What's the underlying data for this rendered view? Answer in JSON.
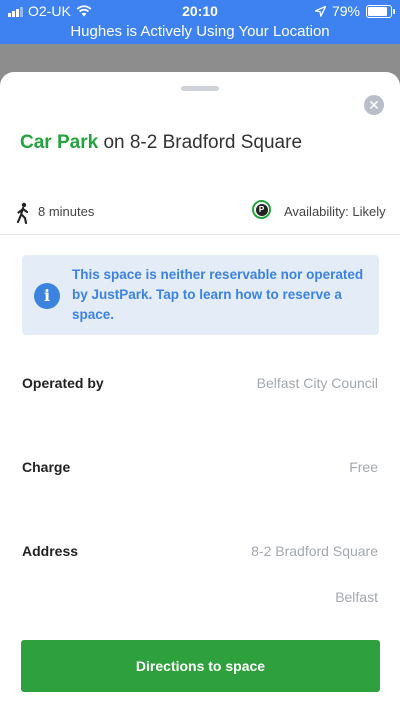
{
  "status_bar": {
    "carrier": "O2-UK",
    "time": "20:10",
    "battery_percent": "79%",
    "battery_level": 0.79,
    "icons": [
      "signal-icon",
      "wifi-icon",
      "location-arrow-icon",
      "battery-icon"
    ]
  },
  "location_banner": "Hughes is Actively Using Your Location",
  "sheet": {
    "title_accent": "Car Park",
    "title_rest": " on 8-2 Bradford Square",
    "walk_time": "8 minutes",
    "availability_badge": "P",
    "availability": "Availability: Likely",
    "info_icon": "i",
    "info_text": "This space is neither reservable nor operated by JustPark. Tap to learn how to reserve a space.",
    "details": [
      {
        "label": "Operated by",
        "value": "Belfast City Council"
      },
      {
        "label": "Charge",
        "value": "Free"
      },
      {
        "label": "Address",
        "value": "8-2 Bradford Square",
        "value2": "Belfast"
      }
    ],
    "directions_label": "Directions to space"
  },
  "colors": {
    "brand_green": "#26a33e",
    "status_blue": "#3d82f0",
    "info_blue": "#3c83e0",
    "info_bg": "#e4ecf8",
    "muted_text": "#a3a8b0"
  }
}
